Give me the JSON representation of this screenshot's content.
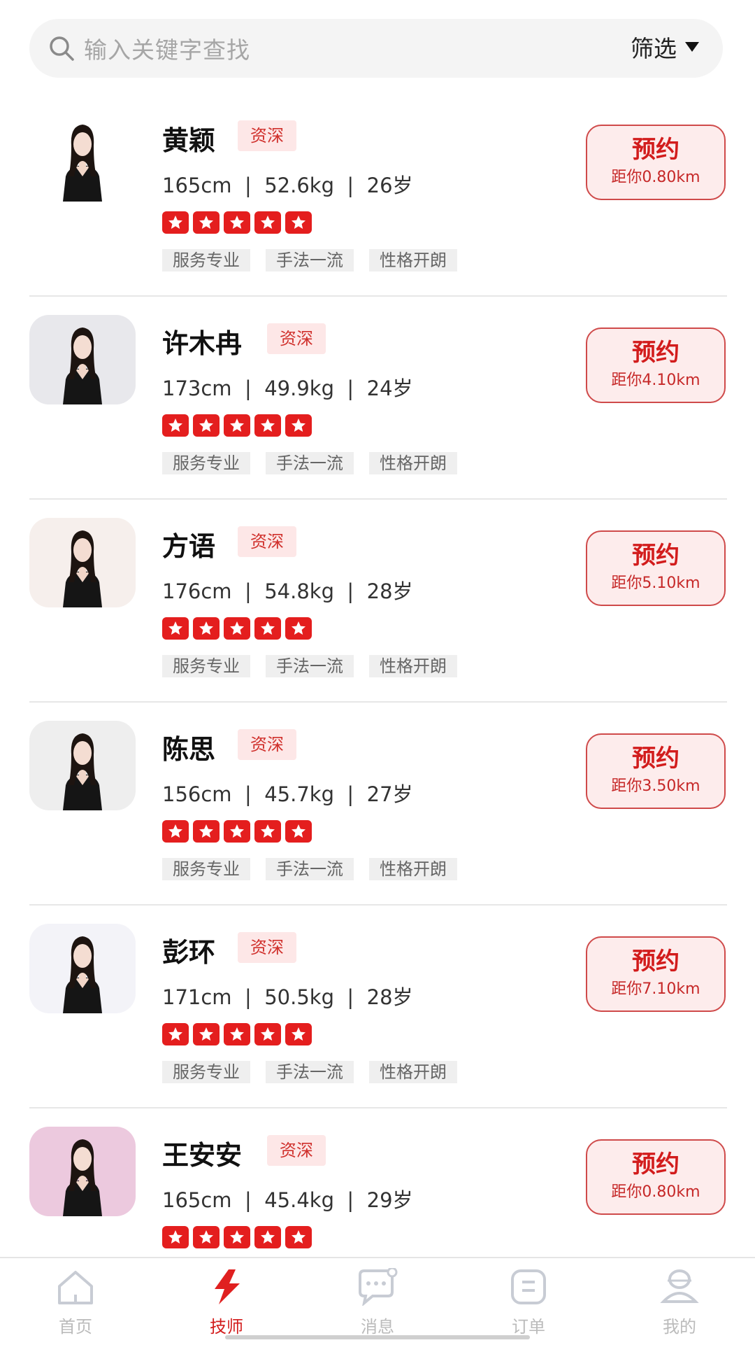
{
  "search": {
    "placeholder": "输入关键字查找",
    "filter_label": "筛选"
  },
  "therapists": [
    {
      "name": "黄颖",
      "badge": "资深",
      "height": "165cm",
      "weight": "52.6kg",
      "age": "26岁",
      "rating": 5,
      "tags": [
        "服务专业",
        "手法一流",
        "性格开朗"
      ],
      "book_label": "预约",
      "distance": "距你0.80km",
      "avatar_bg": "#ffffff"
    },
    {
      "name": "许木冉",
      "badge": "资深",
      "height": "173cm",
      "weight": "49.9kg",
      "age": "24岁",
      "rating": 5,
      "tags": [
        "服务专业",
        "手法一流",
        "性格开朗"
      ],
      "book_label": "预约",
      "distance": "距你4.10km",
      "avatar_bg": "#e8e8ec"
    },
    {
      "name": "方语",
      "badge": "资深",
      "height": "176cm",
      "weight": "54.8kg",
      "age": "28岁",
      "rating": 5,
      "tags": [
        "服务专业",
        "手法一流",
        "性格开朗"
      ],
      "book_label": "预约",
      "distance": "距你5.10km",
      "avatar_bg": "#f6efec"
    },
    {
      "name": "陈思",
      "badge": "资深",
      "height": "156cm",
      "weight": "45.7kg",
      "age": "27岁",
      "rating": 5,
      "tags": [
        "服务专业",
        "手法一流",
        "性格开朗"
      ],
      "book_label": "预约",
      "distance": "距你3.50km",
      "avatar_bg": "#eeeeee"
    },
    {
      "name": "彭环",
      "badge": "资深",
      "height": "171cm",
      "weight": "50.5kg",
      "age": "28岁",
      "rating": 5,
      "tags": [
        "服务专业",
        "手法一流",
        "性格开朗"
      ],
      "book_label": "预约",
      "distance": "距你7.10km",
      "avatar_bg": "#f3f3f8"
    },
    {
      "name": "王安安",
      "badge": "资深",
      "height": "165cm",
      "weight": "45.4kg",
      "age": "29岁",
      "rating": 5,
      "tags": [],
      "book_label": "预约",
      "distance": "距你0.80km",
      "avatar_bg": "#ecc9de"
    }
  ],
  "tabs": [
    {
      "label": "首页",
      "icon": "home-icon",
      "active": false
    },
    {
      "label": "技师",
      "icon": "lightning-icon",
      "active": true
    },
    {
      "label": "消息",
      "icon": "chat-icon",
      "active": false
    },
    {
      "label": "订单",
      "icon": "order-icon",
      "active": false
    },
    {
      "label": "我的",
      "icon": "profile-icon",
      "active": false
    }
  ],
  "colors": {
    "accent": "#d21c1c",
    "badge_bg": "#fde7e7",
    "tag_bg": "#efefef"
  }
}
